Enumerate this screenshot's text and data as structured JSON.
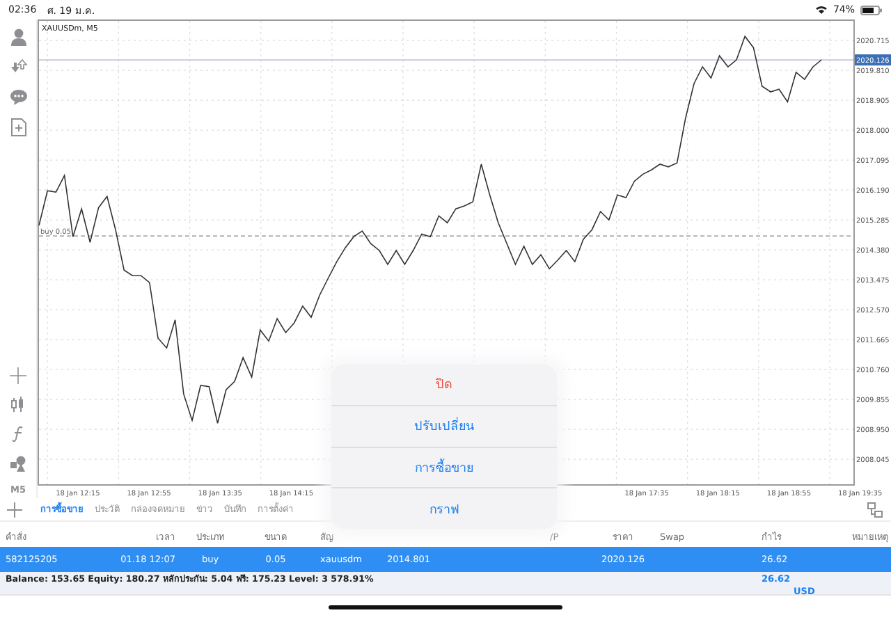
{
  "status_bar": {
    "time": "02:36",
    "date": "ศ. 19 ม.ค.",
    "battery": "74%"
  },
  "toolbar": {
    "timeframe": "M5"
  },
  "chart": {
    "title": "XAUUSDm, M5",
    "time_labels": [
      "18 Jan 12:15",
      "18 Jan 12:55",
      "18 Jan 13:35",
      "18 Jan 14:15",
      "18 Jan 17:35",
      "18 Jan 18:15",
      "18 Jan 18:55",
      "18 Jan 19:35"
    ],
    "chart_data": {
      "type": "line",
      "ylim": [
        2007.29,
        2021.35
      ],
      "grid": true,
      "ref_lines": [
        {
          "axis": "y",
          "value": 2020.126,
          "label": "2020.126",
          "color": "#a6b0cc"
        },
        {
          "axis": "y",
          "value": 2014.801,
          "label": "buy 0.05",
          "color": "#888888"
        }
      ],
      "series": [
        {
          "color": "#333333",
          "values": [
            2015.12,
            2016.17,
            2016.13,
            2016.63,
            2014.78,
            2015.62,
            2014.61,
            2015.66,
            2016.0,
            2014.99,
            2013.77,
            2013.6,
            2013.6,
            2013.39,
            2011.71,
            2011.41,
            2012.26,
            2010.02,
            2009.22,
            2010.28,
            2010.24,
            2009.14,
            2010.15,
            2010.4,
            2011.12,
            2010.53,
            2011.96,
            2011.62,
            2012.3,
            2011.88,
            2012.17,
            2012.68,
            2012.34,
            2013.01,
            2013.52,
            2014.02,
            2014.44,
            2014.78,
            2014.95,
            2014.57,
            2014.36,
            2013.94,
            2014.36,
            2013.94,
            2014.36,
            2014.86,
            2014.78,
            2015.41,
            2015.2,
            2015.62,
            2015.71,
            2015.83,
            2016.97,
            2016.04,
            2015.2,
            2014.57,
            2013.94,
            2014.49,
            2013.94,
            2014.23,
            2013.81,
            2014.07,
            2014.36,
            2014.02,
            2014.7,
            2014.99,
            2015.54,
            2015.29,
            2016.04,
            2015.96,
            2016.46,
            2016.67,
            2016.8,
            2016.97,
            2016.89,
            2017.01,
            2018.36,
            2019.41,
            2019.92,
            2019.58,
            2020.25,
            2019.92,
            2020.13,
            2020.84,
            2020.5,
            2019.33,
            2019.16,
            2019.24,
            2018.86,
            2019.75,
            2019.54,
            2019.92,
            2020.13
          ]
        }
      ],
      "yticks": [
        {
          "value": 2020.715,
          "label": "2020.715"
        },
        {
          "value": 2019.81,
          "label": "2019.810"
        },
        {
          "value": 2018.905,
          "label": "2018.905"
        },
        {
          "value": 2018.0,
          "label": "2018.000"
        },
        {
          "value": 2017.095,
          "label": "2017.095"
        },
        {
          "value": 2016.19,
          "label": "2016.190"
        },
        {
          "value": 2015.285,
          "label": "2015.285"
        },
        {
          "value": 2014.38,
          "label": "2014.380"
        },
        {
          "value": 2013.475,
          "label": "2013.475"
        },
        {
          "value": 2012.57,
          "label": "2012.570"
        },
        {
          "value": 2011.665,
          "label": "2011.665"
        },
        {
          "value": 2010.76,
          "label": "2010.760"
        },
        {
          "value": 2009.855,
          "label": "2009.855"
        },
        {
          "value": 2008.95,
          "label": "2008.950"
        },
        {
          "value": 2008.045,
          "label": "2008.045"
        }
      ]
    }
  },
  "tabs": [
    {
      "label": "การซื้อขาย",
      "selected": true
    },
    {
      "label": "ประวัติ",
      "selected": false
    },
    {
      "label": "กล่องจดหมาย",
      "selected": false
    },
    {
      "label": "ข่าว",
      "selected": false
    },
    {
      "label": "บันทึก",
      "selected": false
    },
    {
      "label": "การตั้งค่า",
      "selected": false
    }
  ],
  "table": {
    "columns": [
      "คำสั่ง",
      "เวลา",
      "ประเภท",
      "ขนาด",
      "สัญ",
      null,
      null,
      "/P",
      "ราคา",
      "Swap",
      "กำไร",
      "หมายเหตุ"
    ],
    "rows": [
      {
        "selected": true,
        "cells": [
          "582125205",
          "01.18 12:07",
          "buy",
          "0.05",
          "xauusdm",
          "2014.801",
          "",
          "",
          "2020.126",
          "",
          "26.62",
          ""
        ]
      }
    ]
  },
  "summary": {
    "text": "Balance: 153.65 Equity: 180.27 หลักประกัน: 5.04 ฟรี: 175.23 Level: 3 578.91%",
    "profit": "26.62",
    "currency": "USD"
  },
  "action_sheet": {
    "items": [
      {
        "label": "ปิด",
        "kind": "destructive"
      },
      {
        "label": "ปรับเปลี่ยน",
        "kind": "default"
      },
      {
        "label": "การซื้อขาย",
        "kind": "default"
      },
      {
        "label": "กราฟ",
        "kind": "default"
      }
    ]
  }
}
